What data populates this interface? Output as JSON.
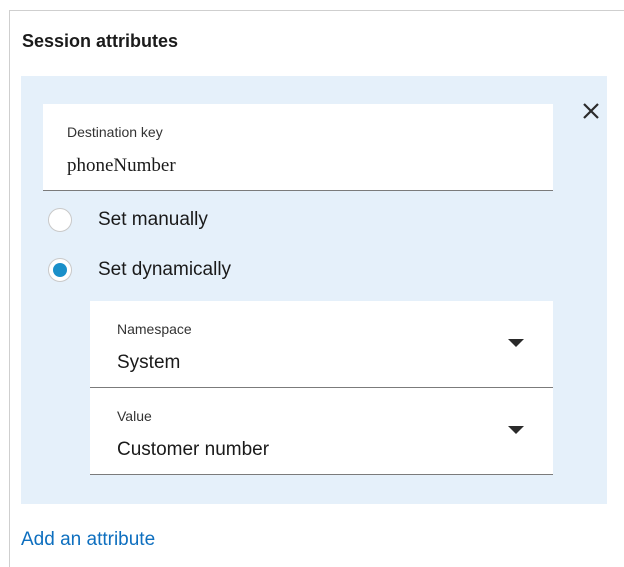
{
  "panel": {
    "title": "Session attributes"
  },
  "attribute": {
    "destination_key": {
      "label": "Destination key",
      "value": "phoneNumber"
    },
    "options": [
      {
        "label": "Set manually",
        "selected": false
      },
      {
        "label": "Set dynamically",
        "selected": true
      }
    ],
    "namespace": {
      "label": "Namespace",
      "value": "System"
    },
    "value": {
      "label": "Value",
      "value": "Customer number"
    },
    "close_icon": "close-icon"
  },
  "actions": {
    "add_attribute": "Add an attribute"
  },
  "colors": {
    "card_background": "#e5f0fa",
    "accent": "#1a8fc9",
    "link": "#0e6fbf"
  }
}
